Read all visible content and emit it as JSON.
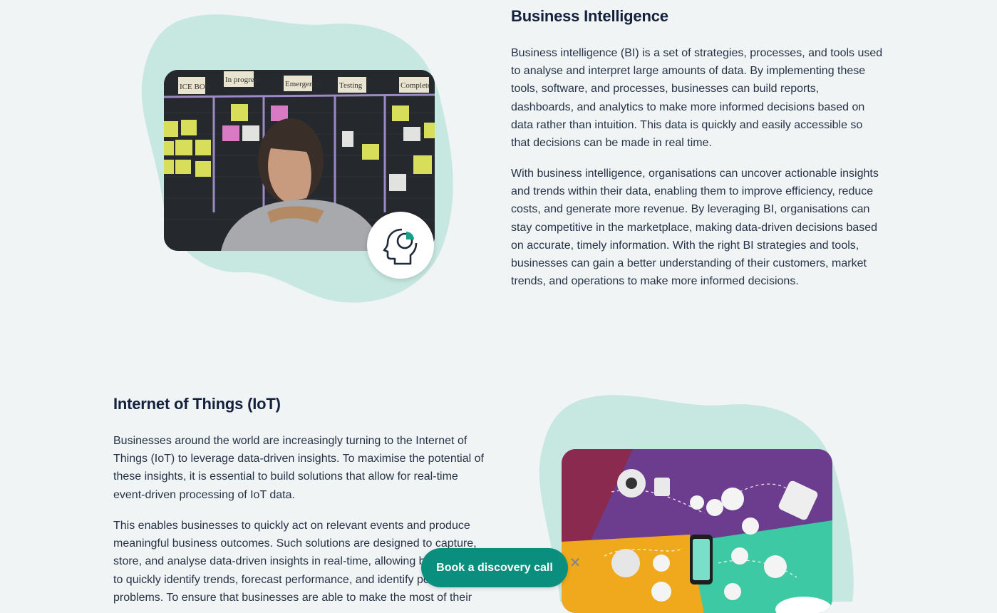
{
  "bi": {
    "title": "Business Intelligence",
    "para1": "Business intelligence (BI) is a set of strategies, processes, and tools used to analyse and interpret large amounts of data. By implementing these tools, software, and processes, businesses can build reports, dashboards, and analytics to make more informed decisions based on data rather than intuition. This data is quickly and easily accessible so that decisions can be made in real time.",
    "para2": "With business intelligence, organisations can uncover actionable insights and trends within their data, enabling them to improve efficiency, reduce costs, and generate more revenue. By leveraging BI, organisations can stay competitive in the marketplace, making data-driven decisions based on accurate, timely information. With the right BI strategies and tools, businesses can gain a better understanding of their customers, market trends, and operations to make more informed decisions.",
    "board_labels": [
      "ICE BOX",
      "In progress",
      "Emergency",
      "Testing",
      "Complete"
    ],
    "icon": "head-chart-icon"
  },
  "iot": {
    "title": "Internet of Things (IoT)",
    "para1": "Businesses around the world are increasingly turning to the Internet of Things (IoT) to leverage data-driven insights. To maximise the potential of these insights, it is essential to build solutions that allow for real-time event-driven processing of IoT data.",
    "para2": "This enables businesses to quickly act on relevant events and produce meaningful business outcomes. Such solutions are designed to capture, store, and analyse data-driven insights in real-time, allowing businesses to quickly identify trends, forecast performance, and identify potential problems. To ensure that businesses are able to make the most of their"
  },
  "cta": {
    "label": "Book a discovery call",
    "close_icon": "close-icon"
  },
  "colors": {
    "background": "#f1f4f5",
    "blob": "#c7e7e1",
    "cta": "#0a8f7f",
    "heading": "#14213d"
  }
}
